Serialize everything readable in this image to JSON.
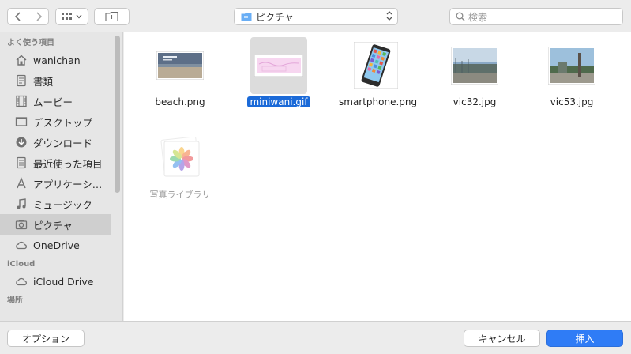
{
  "toolbar": {
    "location": "ピクチャ",
    "search_placeholder": "検索"
  },
  "sidebar": {
    "favorites_header": "よく使う項目",
    "items": [
      {
        "label": "wanichan",
        "icon": "home-icon"
      },
      {
        "label": "書類",
        "icon": "document-icon"
      },
      {
        "label": "ムービー",
        "icon": "film-icon"
      },
      {
        "label": "デスクトップ",
        "icon": "desktop-icon"
      },
      {
        "label": "ダウンロード",
        "icon": "download-icon"
      },
      {
        "label": "最近使った項目",
        "icon": "recent-icon"
      },
      {
        "label": "アプリケーシ…",
        "icon": "apps-icon"
      },
      {
        "label": "ミュージック",
        "icon": "music-icon"
      },
      {
        "label": "ピクチャ",
        "icon": "camera-icon"
      },
      {
        "label": "OneDrive",
        "icon": "cloud-icon"
      }
    ],
    "icloud_header": "iCloud",
    "icloud_items": [
      {
        "label": "iCloud Drive",
        "icon": "cloud-icon"
      }
    ],
    "places_header": "場所"
  },
  "files": [
    {
      "name": "beach.png",
      "selected": false,
      "disabled": false
    },
    {
      "name": "miniwani.gif",
      "selected": true,
      "disabled": false
    },
    {
      "name": "smartphone.png",
      "selected": false,
      "disabled": false
    },
    {
      "name": "vic32.jpg",
      "selected": false,
      "disabled": false
    },
    {
      "name": "vic53.jpg",
      "selected": false,
      "disabled": false
    },
    {
      "name": "写真ライブラリ",
      "selected": false,
      "disabled": true
    }
  ],
  "buttons": {
    "options": "オプション",
    "cancel": "キャンセル",
    "insert": "挿入"
  }
}
